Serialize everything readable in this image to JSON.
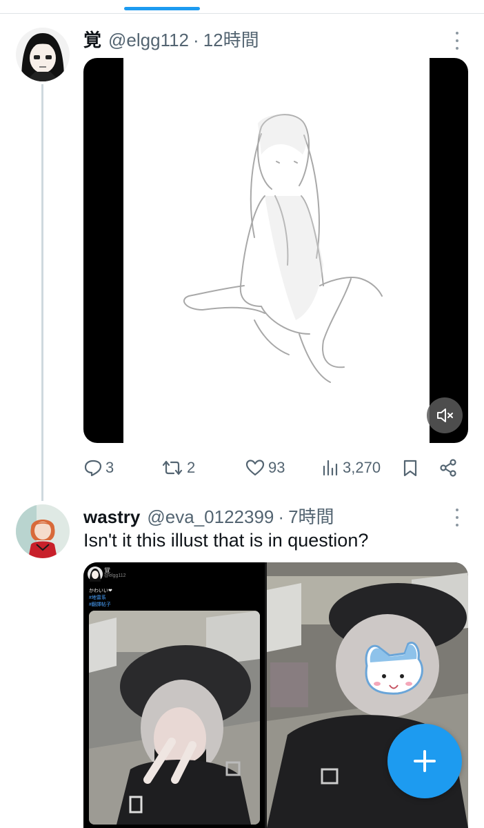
{
  "tweets": [
    {
      "name": "覚",
      "handle": "@elgg112",
      "separator": "·",
      "time": "12時間",
      "metrics": {
        "replies": "3",
        "retweets": "2",
        "likes": "93",
        "views": "3,270"
      }
    },
    {
      "name": "wastry",
      "handle": "@eva_0122399",
      "separator": "·",
      "time": "7時間",
      "text": "Isn't it this illust that is in question?",
      "embedded_screenshot": {
        "name": "覚",
        "handle": "@elgg112",
        "text": "かわいい❤",
        "tags": [
          "#地雷系",
          "#翻譯帖子"
        ]
      }
    }
  ],
  "icons": {
    "reply": "reply-icon",
    "retweet": "retweet-icon",
    "like": "heart-icon",
    "views": "views-icon",
    "bookmark": "bookmark-icon",
    "share": "share-icon",
    "more": "more-icon",
    "mute": "mute-icon",
    "compose": "plus-icon"
  },
  "colors": {
    "accent": "#1d9bf0",
    "text_primary": "#0f1419",
    "text_secondary": "#536471",
    "thread_line": "#cfd9de"
  }
}
